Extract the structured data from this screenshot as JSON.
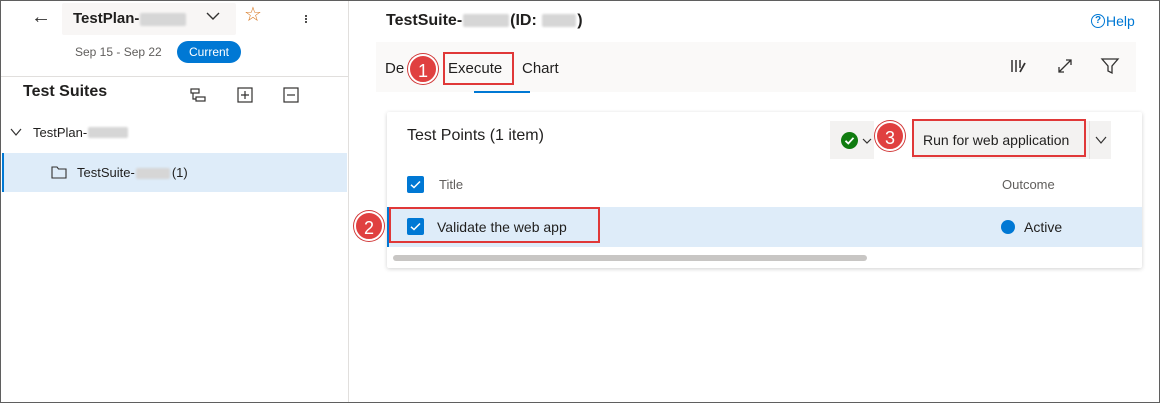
{
  "header": {
    "plan_name": "TestPlan-",
    "date_range": "Sep 15 - Sep 22",
    "current_badge": "Current"
  },
  "sidebar": {
    "title": "Test Suites",
    "tree": {
      "plan_label": "TestPlan-",
      "suite_label": "TestSuite-",
      "suite_count": "(1)"
    }
  },
  "main": {
    "suite_title_prefix": "TestSuite-",
    "suite_title_id": "(ID:",
    "suite_title_close": ")",
    "help_label": "Help",
    "tabs": [
      "De",
      "Execute",
      "Chart"
    ],
    "selected_tab": "Execute"
  },
  "test_points": {
    "title": "Test Points (1 item)",
    "run_button": "Run for web application",
    "columns": [
      "Title",
      "Outcome"
    ],
    "rows": [
      {
        "title": "Validate the web app",
        "outcome": "Active"
      }
    ]
  },
  "callouts": [
    "1",
    "2",
    "3"
  ],
  "colors": {
    "accent": "#0078d4",
    "selected_row": "#deecf9",
    "pass_green": "#107c10",
    "callout_red": "#e03838",
    "star": "#d97a24"
  },
  "icons": [
    "back-arrow-icon",
    "chevron-down-icon",
    "star-icon",
    "more-vertical-icon",
    "expand-tree-icon",
    "add-suite-icon",
    "collapse-icon",
    "folder-icon",
    "help-icon",
    "column-options-icon",
    "fullscreen-icon",
    "filter-icon",
    "pass-check-icon"
  ]
}
